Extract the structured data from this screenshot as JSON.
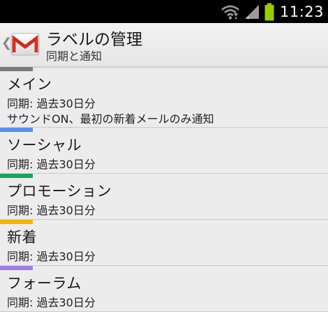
{
  "status_bar": {
    "time": "11:23",
    "icons": [
      "wifi-icon",
      "signal-icon",
      "battery-icon"
    ],
    "battery_color": "#99cc00"
  },
  "action_bar": {
    "title": "ラベルの管理",
    "subtitle": "同期と通知",
    "logo_icon": "gmail-icon"
  },
  "labels": [
    {
      "name": "メイン",
      "color": "#7a7a7a",
      "sync": "同期: 過去30日分",
      "notification": "サウンドON、最初の新着メールのみ通知"
    },
    {
      "name": "ソーシャル",
      "color": "#5b8ef0",
      "sync": "同期: 過去30日分"
    },
    {
      "name": "プロモーション",
      "color": "#1aa260",
      "sync": "同期: 過去30日分"
    },
    {
      "name": "新着",
      "color": "#f4b400",
      "sync": "同期: 過去30日分"
    },
    {
      "name": "フォーラム",
      "color": "#a27ee0",
      "sync": "同期: 過去30日分"
    }
  ]
}
